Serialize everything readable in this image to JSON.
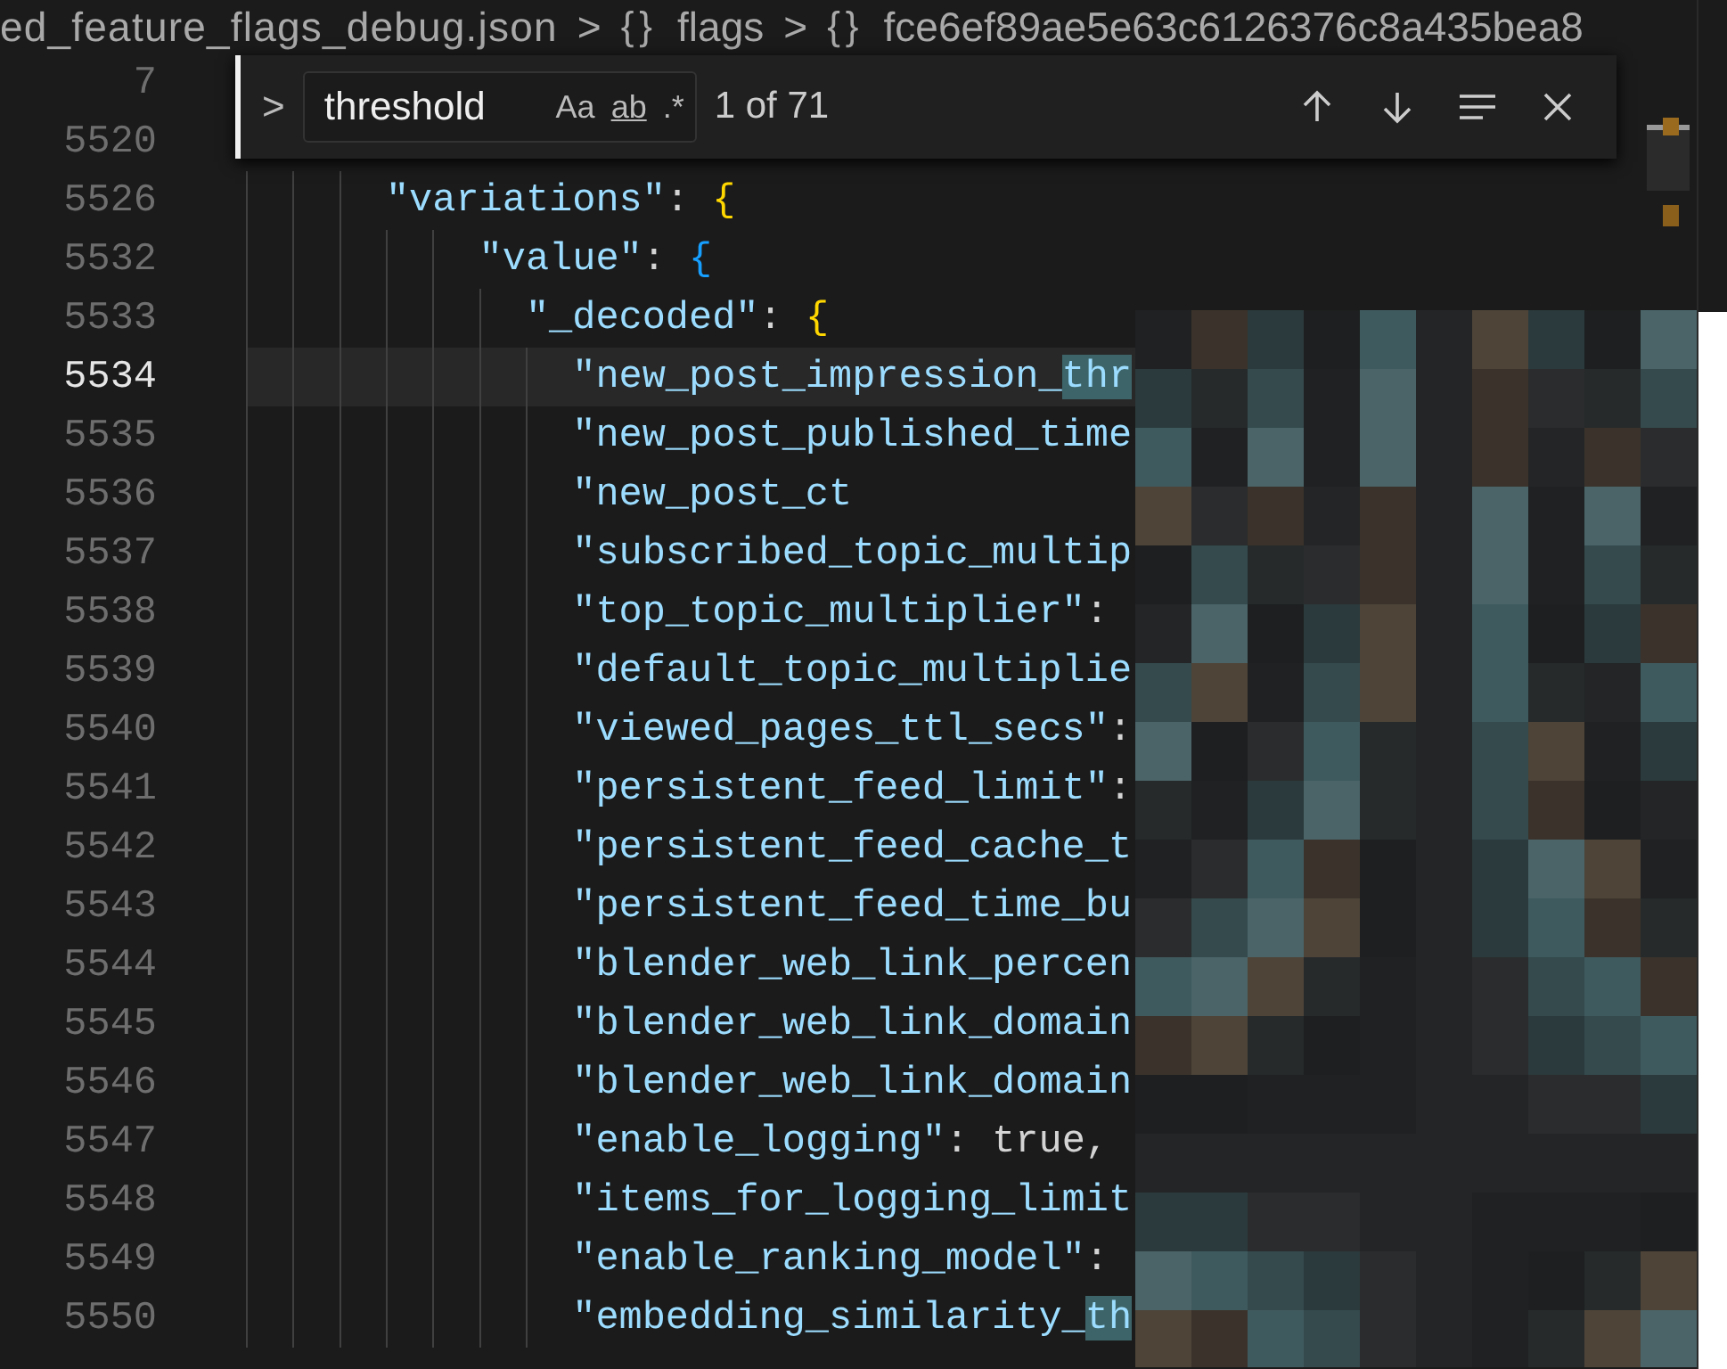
{
  "breadcrumbs": [
    {
      "label": "ed_feature_flags_debug.json"
    },
    {
      "icon": "{}",
      "label": "flags"
    },
    {
      "icon": "{}",
      "label": "fce6ef89ae5e63c6126376c8a435bea8"
    }
  ],
  "breadcrumb_separator": ">",
  "find_widget": {
    "toggle": ">",
    "query": "threshold",
    "options": [
      {
        "label": "Aa",
        "kind": "case"
      },
      {
        "label": "ab",
        "kind": "word"
      },
      {
        "label": ".*",
        "kind": "regex"
      }
    ],
    "count": "1 of 71"
  },
  "lines": [
    {
      "number": "7",
      "current": false
    },
    {
      "number": "5520",
      "current": false
    },
    {
      "number": "5526",
      "current": false,
      "tokens": [
        {
          "kind": "key",
          "text": "\"variations\""
        },
        {
          "kind": "punct",
          "text": ": "
        },
        {
          "kind": "bracket",
          "text": "{",
          "color": "#ffd700"
        }
      ],
      "children": [
        {
          "number": "5532",
          "current": false,
          "tokens": [
            {
              "kind": "key",
              "text": "\"value\""
            },
            {
              "kind": "punct",
              "text": ": "
            },
            {
              "kind": "bracket",
              "text": "{",
              "color": "#179fff"
            }
          ],
          "children": [
            {
              "number": "5533",
              "current": false,
              "tokens": [
                {
                  "kind": "key",
                  "text": "\"_decoded\""
                },
                {
                  "kind": "punct",
                  "text": ": "
                },
                {
                  "kind": "bracket",
                  "text": "{",
                  "color": "#ffd700"
                }
              ],
              "children": [
                {
                  "number": "5534",
                  "current": true,
                  "tokens": [
                    {
                      "kind": "key",
                      "text": "\"new_post_impression_"
                    },
                    {
                      "kind": "match",
                      "text": "thr"
                    }
                  ]
                },
                {
                  "number": "5535",
                  "current": false,
                  "tokens": [
                    {
                      "kind": "key",
                      "text": "\"new_post_published_time"
                    }
                  ]
                },
                {
                  "number": "5536",
                  "current": false,
                  "tokens": [
                    {
                      "kind": "key",
                      "text": "\"new_post_ct"
                    }
                  ]
                },
                {
                  "number": "5537",
                  "current": false,
                  "tokens": [
                    {
                      "kind": "key",
                      "text": "\"subscribed_topic_multip"
                    }
                  ]
                },
                {
                  "number": "5538",
                  "current": false,
                  "tokens": [
                    {
                      "kind": "key",
                      "text": "\"top_topic_multiplier\""
                    },
                    {
                      "kind": "punct",
                      "text": ":"
                    }
                  ]
                },
                {
                  "number": "5539",
                  "current": false,
                  "tokens": [
                    {
                      "kind": "key",
                      "text": "\"default_topic_multiplie"
                    }
                  ]
                },
                {
                  "number": "5540",
                  "current": false,
                  "tokens": [
                    {
                      "kind": "key",
                      "text": "\"viewed_pages_ttl_secs\""
                    },
                    {
                      "kind": "punct",
                      "text": ":"
                    }
                  ]
                },
                {
                  "number": "5541",
                  "current": false,
                  "tokens": [
                    {
                      "kind": "key",
                      "text": "\"persistent_feed_limit\""
                    },
                    {
                      "kind": "punct",
                      "text": ":"
                    }
                  ]
                },
                {
                  "number": "5542",
                  "current": false,
                  "tokens": [
                    {
                      "kind": "key",
                      "text": "\"persistent_feed_cache_t"
                    }
                  ]
                },
                {
                  "number": "5543",
                  "current": false,
                  "tokens": [
                    {
                      "kind": "key",
                      "text": "\"persistent_feed_time_bu"
                    }
                  ]
                },
                {
                  "number": "5544",
                  "current": false,
                  "tokens": [
                    {
                      "kind": "key",
                      "text": "\"blender_web_link_percen"
                    }
                  ]
                },
                {
                  "number": "5545",
                  "current": false,
                  "tokens": [
                    {
                      "kind": "key",
                      "text": "\"blender_web_link_domain"
                    }
                  ]
                },
                {
                  "number": "5546",
                  "current": false,
                  "tokens": [
                    {
                      "kind": "key",
                      "text": "\"blender_web_link_domain"
                    }
                  ]
                },
                {
                  "number": "5547",
                  "current": false,
                  "tokens": [
                    {
                      "kind": "key",
                      "text": "\"enable_logging\""
                    },
                    {
                      "kind": "punct",
                      "text": ": "
                    },
                    {
                      "kind": "literal",
                      "text": "true"
                    },
                    {
                      "kind": "punct",
                      "text": ","
                    }
                  ]
                },
                {
                  "number": "5548",
                  "current": false,
                  "tokens": [
                    {
                      "kind": "key",
                      "text": "\"items_for_logging_limit"
                    }
                  ]
                },
                {
                  "number": "5549",
                  "current": false,
                  "tokens": [
                    {
                      "kind": "key",
                      "text": "\"enable_ranking_model\""
                    },
                    {
                      "kind": "punct",
                      "text": ":"
                    }
                  ]
                },
                {
                  "number": "5550",
                  "current": false,
                  "tokens": [
                    {
                      "kind": "key",
                      "text": "\"embedding_similarity_"
                    },
                    {
                      "kind": "match",
                      "text": "th"
                    }
                  ]
                }
              ]
            }
          ]
        }
      ]
    }
  ]
}
